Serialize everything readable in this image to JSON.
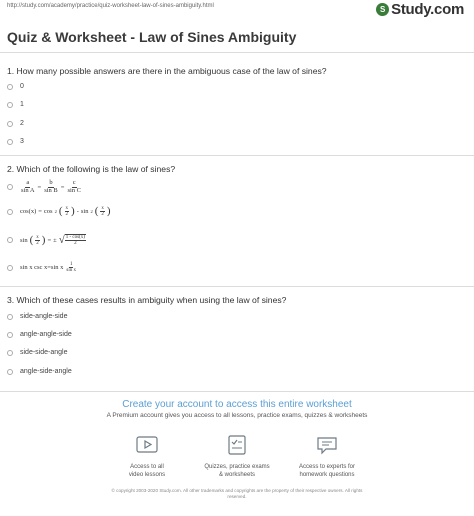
{
  "header": {
    "url": "http://study.com/academy/practice/quiz-worksheet-law-of-sines-ambiguity.html",
    "logo_text": "Study.com",
    "logo_mark": "S"
  },
  "title": "Quiz & Worksheet - Law of Sines Ambiguity",
  "questions": [
    {
      "text": "1. How many possible answers are there in the ambiguous case of the law of sines?",
      "options": [
        "0",
        "1",
        "2",
        "3"
      ]
    },
    {
      "text": "2. Which of the following is the law of sines?",
      "math": {
        "a": {
          "a": "a",
          "sinA": "sin A",
          "b": "b",
          "sinB": "sin B",
          "c": "c",
          "sinC": "sin C",
          "eq": "="
        },
        "b": {
          "cosx": "cos(x)",
          "eq": "=",
          "cos": "cos",
          "sq": "2",
          "x": "x",
          "two": "2",
          "minus": "-",
          "sin": "sin"
        },
        "c": {
          "sin": "sin",
          "x": "x",
          "two": "2",
          "eq": "=",
          "pm": "±",
          "num": "1 - cos(x)",
          "den": "2"
        },
        "d": {
          "text": "sin x csc x=sin x",
          "one": "1",
          "den": "sin x"
        }
      }
    },
    {
      "text": "3. Which of these cases results in ambiguity when using the law of sines?",
      "options": [
        "side-angle-side",
        "angle-angle-side",
        "side-side-angle",
        "angle-side-angle"
      ]
    }
  ],
  "cta": {
    "title": "Create your account to access this entire worksheet",
    "subtitle": "A Premium account gives you access to all lessons, practice exams, quizzes & worksheets"
  },
  "features": [
    {
      "icon": "video-icon",
      "line1": "Access to all",
      "line2": "video lessons"
    },
    {
      "icon": "quiz-icon",
      "line1": "Quizzes, practice exams",
      "line2": "& worksheets"
    },
    {
      "icon": "chat-icon",
      "line1": "Access to experts for",
      "line2": "homework questions"
    }
  ],
  "copyright": {
    "line1": "© copyright 2003-2020 Study.com. All other trademarks and copyrights are the property of their respective owners. All rights",
    "line2": "reserved."
  },
  "colors": {
    "accent": "#5a9fd4",
    "logo": "#3a7d3a",
    "icon_stroke": "#6d7b85"
  }
}
